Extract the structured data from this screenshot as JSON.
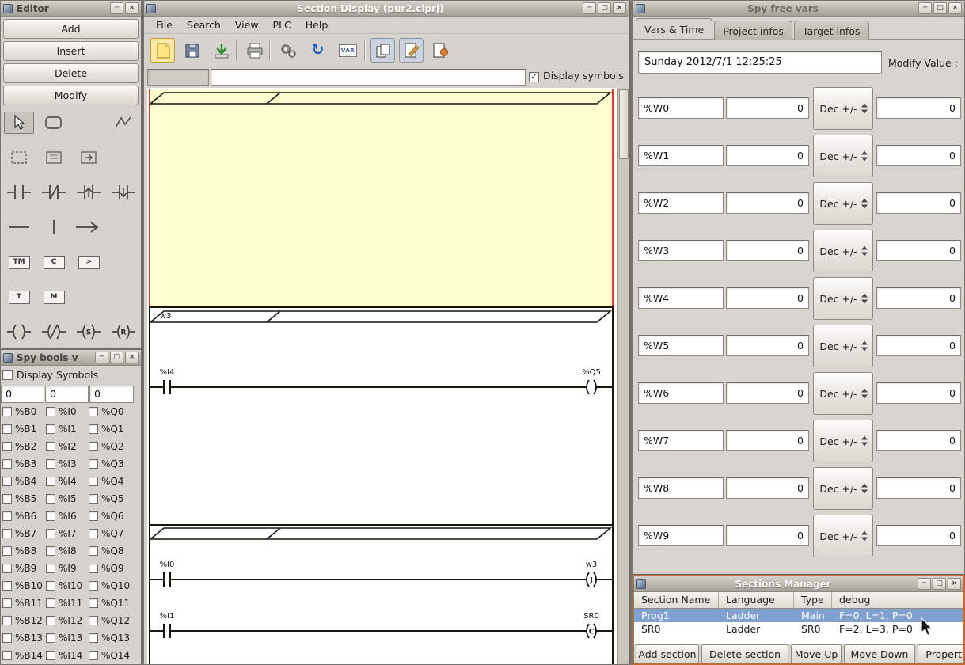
{
  "icons": {
    "minimize": "─",
    "maximize": "□",
    "close": "×",
    "refresh": "↻",
    "check": "✓"
  },
  "editor": {
    "title": "Editor",
    "buttons": {
      "add": "Add",
      "insert": "Insert",
      "delete": "Delete",
      "modify": "Modify"
    },
    "block_labels": {
      "timer": "TM",
      "counter": "C",
      "compare": ">",
      "new_timer": "T",
      "monostable": "M"
    },
    "coil_labels": {
      "set": "S",
      "reset": "R"
    }
  },
  "spy_bools": {
    "title": "Spy bools v",
    "display_symbols_label": "Display Symbols",
    "offset_inputs": [
      "0",
      "0",
      "0"
    ],
    "rows": [
      [
        "%B0",
        "%I0",
        "%Q0"
      ],
      [
        "%B1",
        "%I1",
        "%Q1"
      ],
      [
        "%B2",
        "%I2",
        "%Q2"
      ],
      [
        "%B3",
        "%I3",
        "%Q3"
      ],
      [
        "%B4",
        "%I4",
        "%Q4"
      ],
      [
        "%B5",
        "%I5",
        "%Q5"
      ],
      [
        "%B6",
        "%I6",
        "%Q6"
      ],
      [
        "%B7",
        "%I7",
        "%Q7"
      ],
      [
        "%B8",
        "%I8",
        "%Q8"
      ],
      [
        "%B9",
        "%I9",
        "%Q9"
      ],
      [
        "%B10",
        "%I10",
        "%Q10"
      ],
      [
        "%B11",
        "%I11",
        "%Q11"
      ],
      [
        "%B12",
        "%I12",
        "%Q12"
      ],
      [
        "%B13",
        "%I13",
        "%Q13"
      ],
      [
        "%B14",
        "%I14",
        "%Q14"
      ]
    ]
  },
  "section_display": {
    "title": "Section Display (pur2.clprj)",
    "menus": [
      "File",
      "Search",
      "View",
      "PLC",
      "Help"
    ],
    "display_symbols_label": "Display symbols",
    "toolbar_var_label": "VAR",
    "ladder": {
      "rung2_label": "w3",
      "rungs": [
        {
          "contact": "%I4",
          "coil": "%Q5",
          "coil_letter": ""
        },
        {
          "contact": "%I0",
          "coil": "w3",
          "coil_letter": "J"
        },
        {
          "contact": "%I1",
          "coil": "SR0",
          "coil_letter": "C"
        }
      ]
    }
  },
  "spy_free_vars": {
    "title": "Spy free vars",
    "tabs": [
      "Vars & Time",
      "Project infos",
      "Target infos"
    ],
    "active_tab": 0,
    "datetime": "Sunday 2012/7/1 12:25:25",
    "modify_value_label": "Modify Value :",
    "format_label": "Dec +/-",
    "vars": [
      {
        "name": "%W0",
        "value": "0",
        "modify": "0"
      },
      {
        "name": "%W1",
        "value": "0",
        "modify": "0"
      },
      {
        "name": "%W2",
        "value": "0",
        "modify": "0"
      },
      {
        "name": "%W3",
        "value": "0",
        "modify": "0"
      },
      {
        "name": "%W4",
        "value": "0",
        "modify": "0"
      },
      {
        "name": "%W5",
        "value": "0",
        "modify": "0"
      },
      {
        "name": "%W6",
        "value": "0",
        "modify": "0"
      },
      {
        "name": "%W7",
        "value": "0",
        "modify": "0"
      },
      {
        "name": "%W8",
        "value": "0",
        "modify": "0"
      },
      {
        "name": "%W9",
        "value": "0",
        "modify": "0"
      }
    ]
  },
  "sections_manager": {
    "title": "Sections Manager",
    "columns": [
      "Section Name",
      "Language",
      "Type",
      "debug"
    ],
    "rows": [
      {
        "name": "Prog1",
        "language": "Ladder",
        "type": "Main",
        "debug": "F=0, L=1, P=0",
        "selected": true
      },
      {
        "name": "SR0",
        "language": "Ladder",
        "type": "SR0",
        "debug": "F=2, L=3, P=0",
        "selected": false
      }
    ],
    "buttons": [
      "Add section",
      "Delete section",
      "Move Up",
      "Move Down",
      "Properties"
    ]
  }
}
